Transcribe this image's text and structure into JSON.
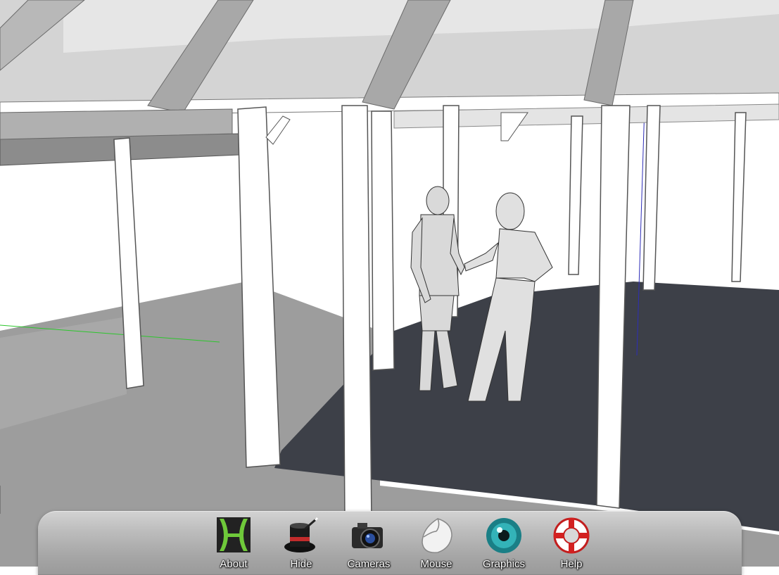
{
  "toolbar": {
    "items": [
      {
        "label": "About",
        "icon": "hypercosm-h-icon"
      },
      {
        "label": "Hide",
        "icon": "magic-hat-icon"
      },
      {
        "label": "Cameras",
        "icon": "camera-icon"
      },
      {
        "label": "Mouse",
        "icon": "mouse-icon"
      },
      {
        "label": "Graphics",
        "icon": "eye-icon"
      },
      {
        "label": "Help",
        "icon": "lifebuoy-icon"
      }
    ]
  },
  "colors": {
    "floor_light": "#9c9c9c",
    "floor_dark": "#3c3f47",
    "wall": "#ffffff",
    "beam": "#b5b5b5",
    "axis_green": "#2cc62c",
    "axis_blue": "#2d2db8"
  }
}
